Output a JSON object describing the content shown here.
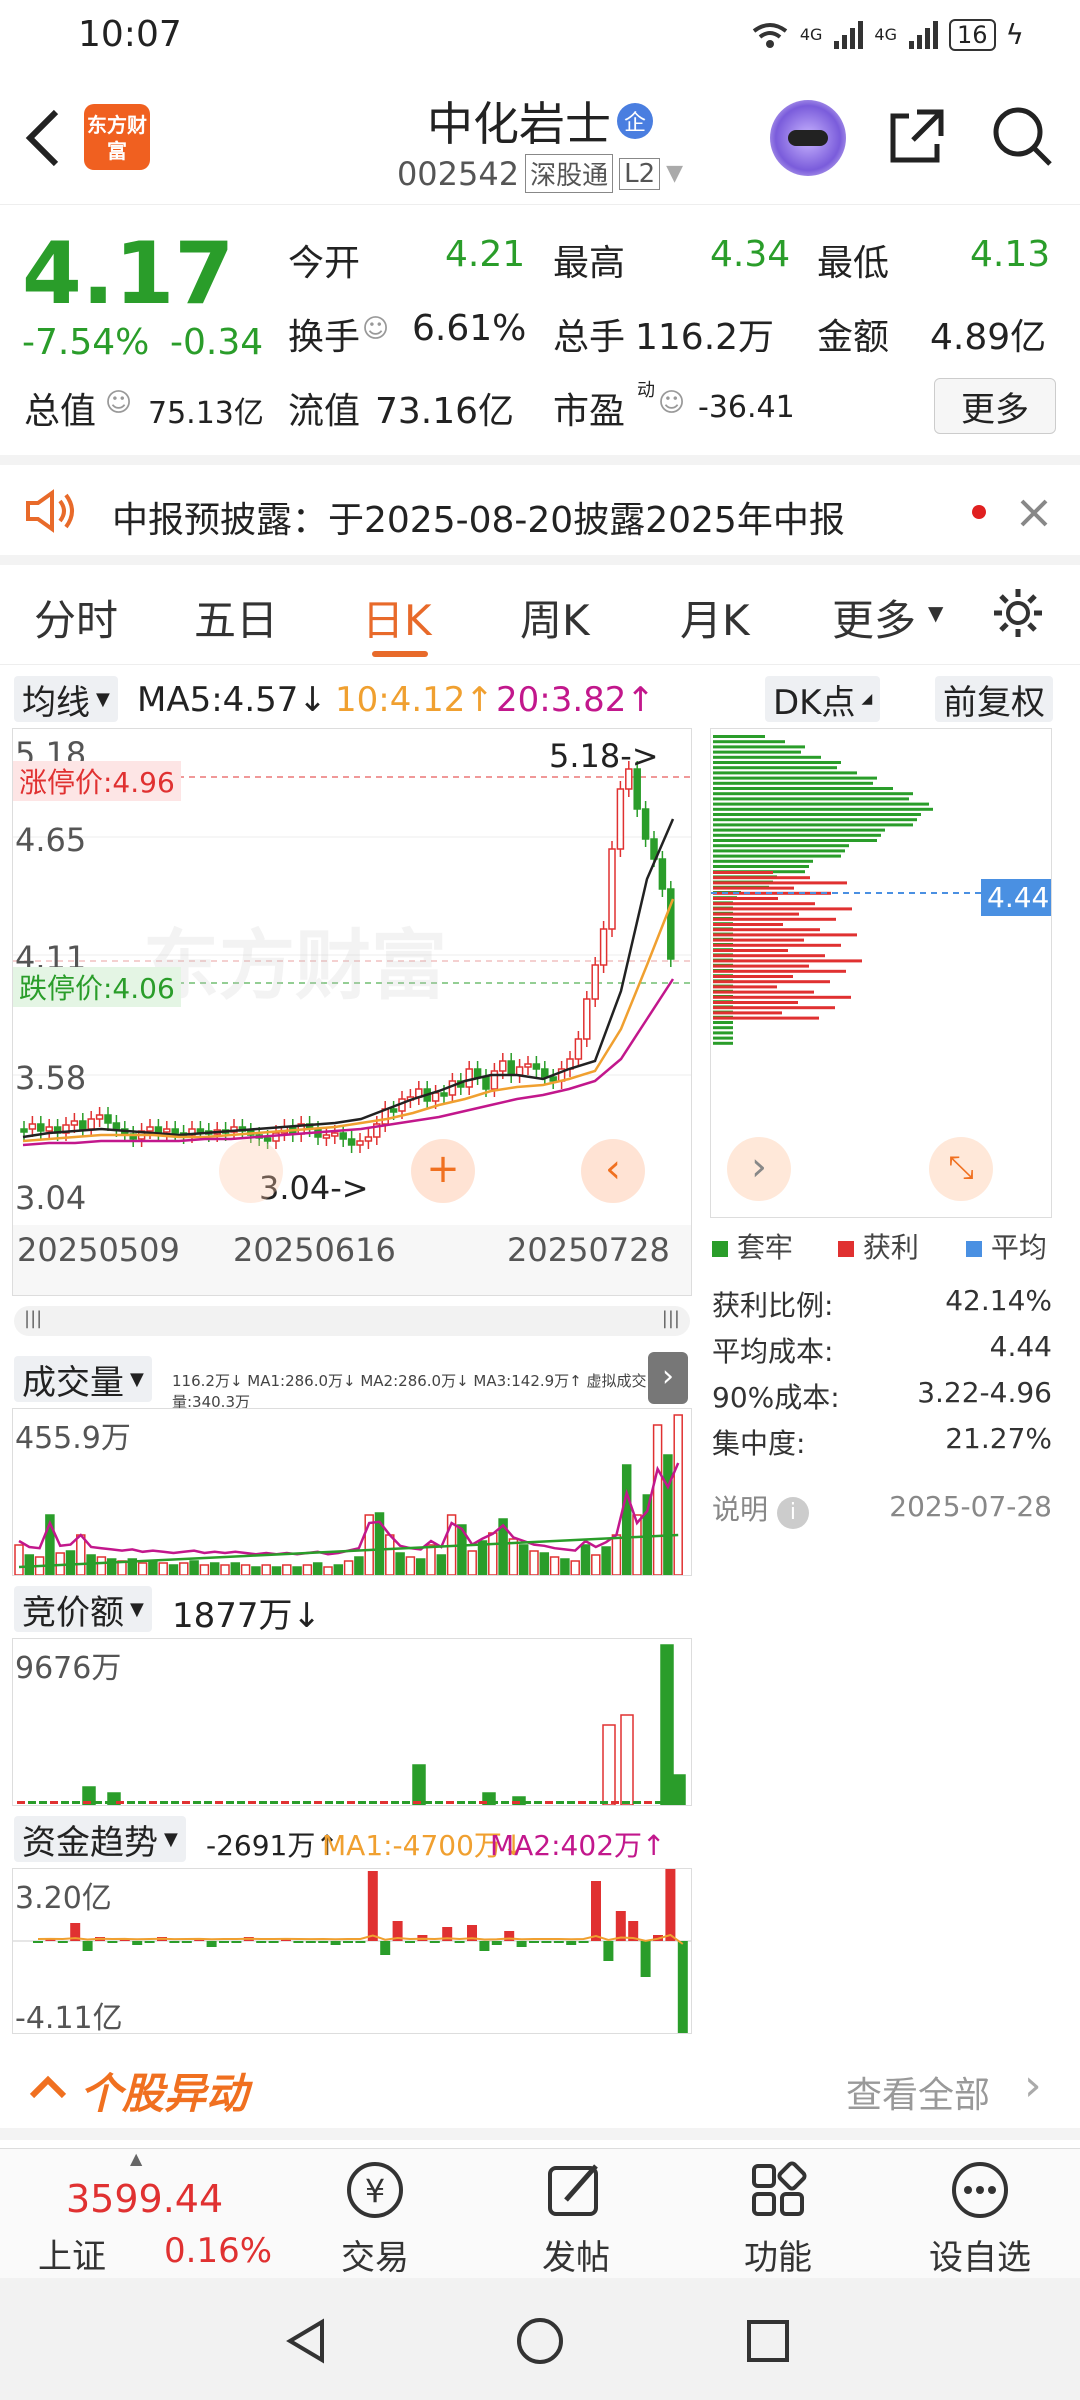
{
  "status": {
    "time": "10:07",
    "battery": "16",
    "net1": "4G",
    "net2": "4G"
  },
  "header": {
    "title": "中化岩士",
    "badge": "企",
    "logo": "东方财富",
    "code": "002542",
    "tag1": "深股通",
    "tag2": "L2"
  },
  "quote": {
    "price": "4.17",
    "change_pct": "-7.54%",
    "change": "-0.34",
    "open_label": "今开",
    "open": "4.21",
    "high_label": "最高",
    "high": "4.34",
    "low_label": "最低",
    "low": "4.13",
    "turnover_label": "换手",
    "turnover": "6.61%",
    "volume_label": "总手",
    "volume": "116.2万",
    "amount_label": "金额",
    "amount": "4.89亿",
    "mcap_label": "总值",
    "mcap": "75.13亿",
    "float_label": "流值",
    "float": "73.16亿",
    "pe_label": "市盈",
    "pe_sup": "动",
    "pe": "-36.41",
    "more": "更多"
  },
  "notice": {
    "text": "中报预披露：于2025-08-20披露2025年中报"
  },
  "tabs": [
    "分时",
    "五日",
    "日K",
    "周K",
    "月K",
    "更多"
  ],
  "active_tab": "日K",
  "ma": {
    "selector": "均线",
    "ma5": "MA5:4.57",
    "ma5_arrow": "↓",
    "ma10": "10:4.12",
    "ma10_arrow": "↑",
    "ma20": "20:3.82",
    "ma20_arrow": "↑",
    "dk": "DK点",
    "fq": "前复权"
  },
  "kchart": {
    "y_ticks": [
      "5.18",
      "4.65",
      "4.11",
      "3.58",
      "3.04"
    ],
    "limit_up": "涨停价:4.96",
    "limit_down": "跌停价:4.06",
    "high_mark": "5.18",
    "low_mark": "3.04",
    "dates": [
      "20250509",
      "20250616",
      "20250728"
    ],
    "watermark": "东方财富"
  },
  "chips": {
    "avg_label": "4.44",
    "legend": [
      "套牢",
      "获利",
      "平均"
    ],
    "profit_ratio_label": "获利比例:",
    "profit_ratio": "42.14%",
    "avg_cost_label": "平均成本:",
    "avg_cost": "4.44",
    "cost90_label": "90%成本:",
    "cost90": "3.22-4.96",
    "concentration_label": "集中度:",
    "concentration": "21.27%",
    "note": "说明",
    "date": "2025-07-28"
  },
  "volume": {
    "selector": "成交量",
    "info": "116.2万↓ MA1:286.0万↓ MA2:286.0万↓ MA3:142.9万↑ 虚拟成交量:340.3万",
    "max": "455.9万"
  },
  "auction": {
    "selector": "竞价额",
    "value": "1877万",
    "arrow": "↓",
    "max": "9676万"
  },
  "fund": {
    "selector": "资金趋势",
    "value": "-2691万↑",
    "ma1": "MA1:-4700万↓",
    "ma2": "MA2:402万↑",
    "max": "3.20亿",
    "min": "-4.11亿"
  },
  "movement": {
    "title": "个股异动",
    "view_all": "查看全部"
  },
  "bottom": {
    "index_value": "3599.44",
    "index_name": "上证",
    "index_pct": "0.16%",
    "trade": "交易",
    "post": "发帖",
    "func": "功能",
    "watch": "设自选"
  },
  "colors": {
    "up": "#e03131",
    "down": "#2a9d2a",
    "accent": "#f07020"
  }
}
